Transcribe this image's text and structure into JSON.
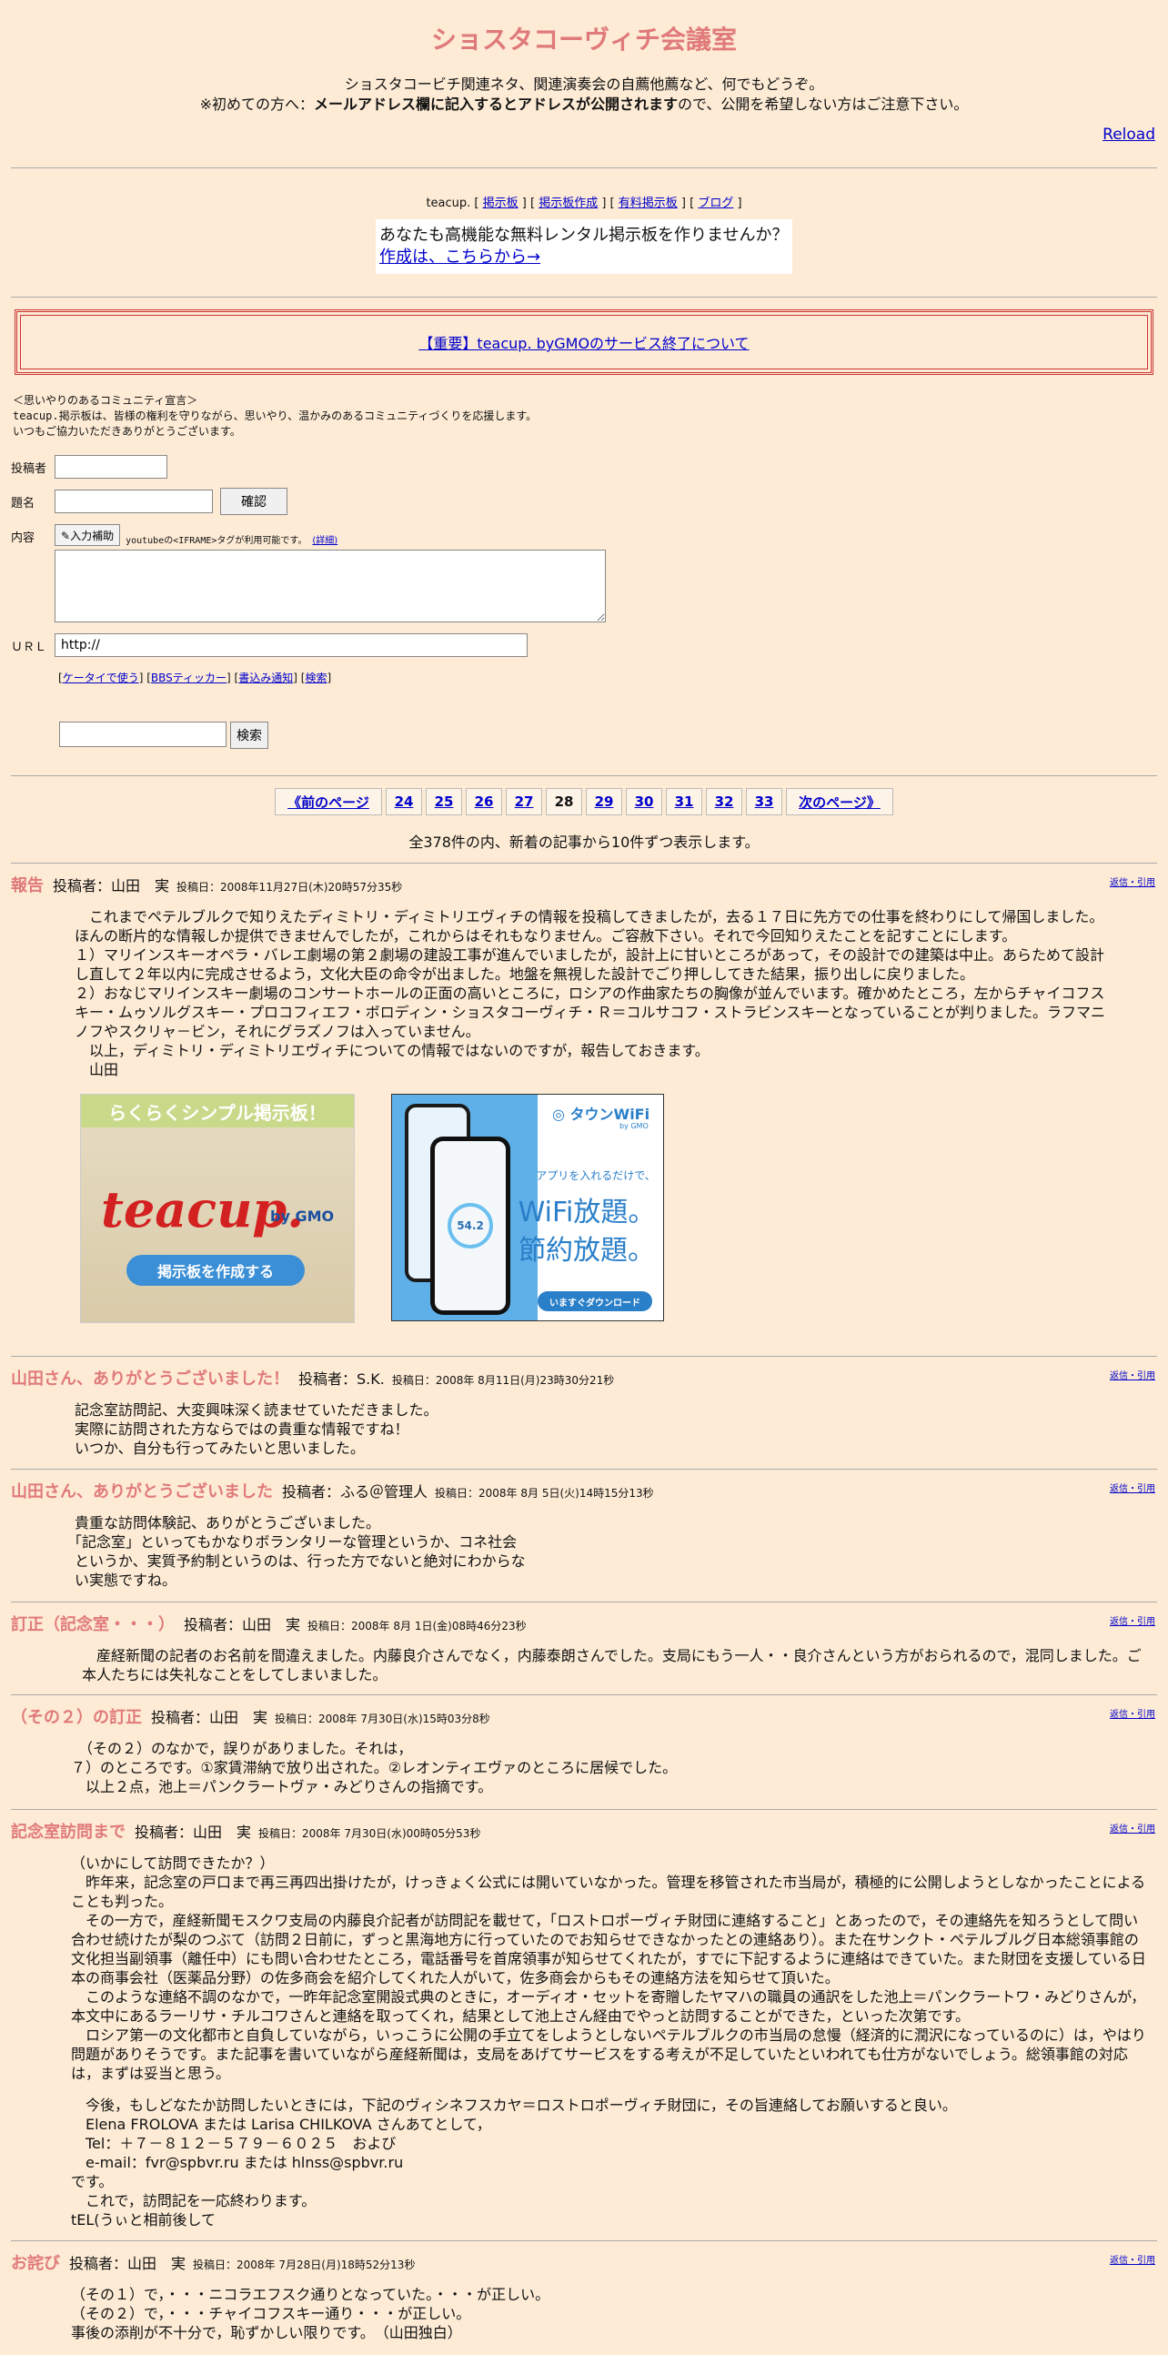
{
  "header": {
    "title": "ショスタコーヴィチ会議室",
    "intro_line1": "ショスタコービチ関連ネタ、関連演奏会の自薦他薦など、何でもどうぞ。",
    "intro_line2_a": "※初めての方へ：",
    "intro_line2_b": "メールアドレス欄に記入するとアドレスが公開されます",
    "intro_line2_c": "ので、公開を希望しない方はご注意下さい。",
    "reload": "Reload"
  },
  "nav": {
    "brand": "teacup.",
    "links": [
      "掲示板",
      "掲示板作成",
      "有料掲示板",
      "ブログ"
    ]
  },
  "adbox": {
    "line1": "あなたも高機能な無料レンタル掲示板を作りませんか？",
    "line2": "作成は、こちらから→"
  },
  "notice": "【重要】teacup. byGMOのサービス終了について",
  "declaration": {
    "line1": "＜思いやりのあるコミュニティ宣言＞",
    "line2": "teacup.掲示板は、皆様の権利を守りながら、思いやり、温かみのあるコミュニティづくりを応援します。",
    "line3": "いつもご協力いただきありがとうございます。"
  },
  "form": {
    "author_label": "投稿者",
    "subject_label": "題名",
    "confirm_button": "確認",
    "content_label": "内容",
    "assist_button": "入力補助",
    "youtube_note": "youtubeの<IFRAME>タグが利用可能です。",
    "youtube_detail": "(詳細)",
    "url_label": "ＵＲＬ",
    "url_value": "http://",
    "links": [
      "ケータイで使う",
      "BBSティッカー",
      "書込み通知",
      "検索"
    ],
    "search_button": "検索"
  },
  "pager": {
    "prev": "《前のページ",
    "pages": [
      "24",
      "25",
      "26",
      "27",
      "28",
      "29",
      "30",
      "31",
      "32",
      "33"
    ],
    "current": "28",
    "next": "次のページ》",
    "count_text": "全378件の内、新着の記事から10件ずつ表示します。"
  },
  "reply_label": "返信・引用",
  "ads": {
    "ad1_title": "らくらくシンプル掲示板！",
    "ad1_brand": "teacup.",
    "ad1_by": "by GMO",
    "ad1_button": "掲示板を作成する",
    "ad2_brand": "タウンWiFi",
    "ad2_by": "by GMO",
    "ad2_line1": "アプリを入れるだけで、",
    "ad2_line2": "WiFi放題。",
    "ad2_line3": "節約放題。",
    "ad2_speed": "54.2",
    "ad2_button": "いますぐダウンロード"
  },
  "posts": [
    {
      "title": "報告",
      "author": "投稿者：山田　実",
      "date": "投稿日：2008年11月27日(木)20時57分35秒",
      "lines": [
        "　これまでペテルブルクで知りえたディミトリ・ディミトリエヴィチの情報を投稿してきましたが，去る１７日に先方での仕事を終わりにして帰国しました。ほんの断片的な情報しか提供できませんでしたが，これからはそれもなりません。ご容赦下さい。それで今回知りえたことを記すことにします。",
        "１）マリインスキーオペラ・バレエ劇場の第２劇場の建設工事が進んでいましたが，設計上に甘いところがあって，その設計での建築は中止。あらためて設計し直して２年以内に完成させるよう，文化大臣の命令が出ました。地盤を無視した設計でごり押ししてきた結果，振り出しに戻りました。",
        "２）おなじマリインスキー劇場のコンサートホールの正面の高いところに，ロシアの作曲家たちの胸像が並んでいます。確かめたところ，左からチャイコフスキー・ムゥソルグスキー・プロコフィエフ・ボロディン・ショスタコーヴィチ・Ｒ＝コルサコフ・ストラビンスキーとなっていることが判りました。ラフマニノフやスクリャ－ビン，それにグラズノフは入っていません。",
        "　以上，ディミトリ・ディミトリエヴィチについての情報ではないのですが，報告しておきます。",
        "　山田"
      ]
    },
    {
      "title": "山田さん、ありがとうございました！",
      "author": "投稿者：S.K.",
      "date": "投稿日：2008年 8月11日(月)23時30分21秒",
      "lines": [
        "　記念室訪問記、大変興味深く読ませていただきました。",
        "　実際に訪問された方ならではの貴重な情報ですね！",
        "　いつか、自分も行ってみたいと思いました。"
      ]
    },
    {
      "title": "山田さん、ありがとうございました",
      "author": "投稿者：ふる＠管理人",
      "date": "投稿日：2008年 8月 5日(火)14時15分13秒",
      "lines": [
        "　貴重な訪問体験記、ありがとうございました。",
        "　「記念室」といってもかなりボランタリーな管理というか、コネ社会",
        "　というか、実質予約制というのは、行った方でないと絶対にわからな",
        "　い実態ですね。"
      ]
    },
    {
      "title": "訂正（記念室・・・）",
      "author": "投稿者：山田　実",
      "date": "投稿日：2008年 8月 1日(金)08時46分23秒",
      "lines": [
        "　産経新聞の記者のお名前を間違えました。内藤良介さんでなく，内藤泰朗さんでした。支局にもう一人・・良介さんという方がおられるので，混同しました。ご本人たちには失礼なことをしてしまいました。"
      ]
    },
    {
      "title": "（その２）の訂正",
      "author": "投稿者：山田　実",
      "date": "投稿日：2008年 7月30日(水)15時03分8秒",
      "lines": [
        "　（その２）のなかで，誤りがありました。それは，",
        "７）のところです。①家賃滞納で放り出された。②レオンティエヴァのところに居候でした。",
        "　以上２点，池上＝パンクラートヴァ・みどりさんの指摘です。"
      ]
    },
    {
      "title": "記念室訪問まで",
      "author": "投稿者：山田　実",
      "date": "投稿日：2008年 7月30日(水)00時05分53秒",
      "lines": [
        "（いかにして訪問できたか？）",
        "　昨年来，記念室の戸口まで再三再四出掛けたが，けっきょく公式には開いていなかった。管理を移管された市当局が，積極的に公開しようとしなかったことによることも判った。",
        "　その一方で，産経新聞モスクワ支局の内藤良介記者が訪問記を載せて，「ロストロポーヴィチ財団に連絡すること」とあったので，その連絡先を知ろうとして問い合わせ続けたが梨のつぶて（訪問２日前に，ずっと黒海地方に行っていたのでお知らせできなかったとの連絡あり）。また在サンクト・ペテルブルグ日本総領事館の文化担当副領事（離任中）にも問い合わせたところ，電話番号を首席領事が知らせてくれたが，すでに下記するように連絡はできていた。また財団を支援している日本の商事会社（医薬品分野）の佐多商会を紹介してくれた人がいて，佐多商会からもその連絡方法を知らせて頂いた。",
        "　このような連絡不調のなかで，一昨年記念室開設式典のときに，オーディオ・セットを寄贈したヤマハの職員の通訳をした池上＝パンクラートワ・みどりさんが，本文中にあるラーリサ・チルコワさんと連絡を取ってくれ，結果として池上さん経由でやっと訪問することができた，といった次第です。",
        "　ロシア第一の文化都市と自負していながら，いっこうに公開の手立てをしようとしないペテルブルクの市当局の怠慢（経済的に潤沢になっているのに）は，やはり問題がありそうです。また記事を書いていながら産経新聞は，支局をあげてサービスをする考えが不足していたといわれても仕方がないでしょう。総領事館の対応は，まずは妥当と思う。",
        "",
        "　今後，もしどなたか訪問したいときには，下記のヴィシネフスカヤ＝ロストロポーヴィチ財団に，その旨連絡してお願いすると良い。",
        "　Elena FROLOVA または Larisa CHILKOVA さんあてとして，",
        "　Tel：＋７－８１２－５７９－６０２５　および",
        "　e-mail：fvr@spbvr.ru または hlnss@spbvr.ru",
        "です。",
        "　これで，訪問記を一応終わります。",
        "tEL(うぃと相前後して"
      ]
    },
    {
      "title": "お詫び",
      "author": "投稿者：山田　実",
      "date": "投稿日：2008年 7月28日(月)18時52分13秒",
      "lines": [
        "（その１）で，・・・ニコラエフスク通りとなっていた。・・・が正しい。",
        "（その２）で，・・・チャイコフスキー通り・・・が正しい。",
        "事後の添削が不十分で，恥ずかしい限りです。　（山田独白）"
      ]
    }
  ]
}
